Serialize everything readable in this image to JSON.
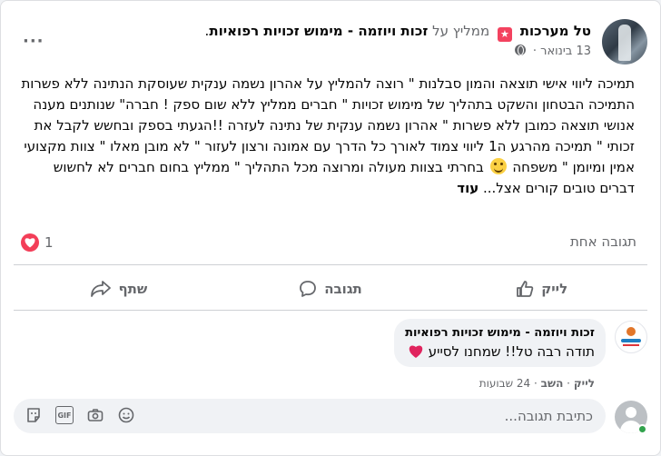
{
  "post": {
    "author_name": "טל מערכות",
    "recommends_word": "ממליץ על",
    "page_name": "זכות ויוזמה - מימוש זכויות רפואיות",
    "date": "13 בינואר",
    "more_options": "···",
    "body_lines": [
      "תמיכה ליווי אישי תוצאה והמון סבלנות \" רוצה להמליץ על אהרון נשמה ענקית שעוסקת",
      "הנתינה ללא פשרות התמיכה הבטחון והשקט בתהליך של מימוש זכויות \" חברים ממליץ",
      "ללא שום ספק ! חברה\" שנותנים מענה אנושי תוצאה כמובן ללא פשרות \" אהרון נשמה",
      "ענקית של נתינה לעזרה !!הגעתי בספק ובחשש לקבל את זכותי \" תמיכה מהרגע ה1 ליווי",
      "צמוד לאורך כל הדרך עם אמונה ורצון לעזור \" לא מובן מאלו \" צוות מקצועי אמין ומיומן \"",
      "משפחה",
      "בחרתי בצוות מעולה ומרוצה מכל התהליך \" ממליץ בחום חברים לא לחשוש",
      "דברים טובים קורים אצל...",
      "עוד"
    ]
  },
  "stats": {
    "reaction_count": "1",
    "comments_count": "תגובה אחת"
  },
  "actions": {
    "like": "לייק",
    "comment": "תגובה",
    "share": "שתף"
  },
  "comment": {
    "author": "זכות ויוזמה - מימוש זכויות רפואיות",
    "text": "תודה רבה טל!! שמחנו לסייע",
    "like": "לייק",
    "reply": "השב",
    "separator": "·",
    "time": "24 שבועות"
  },
  "composer": {
    "placeholder": "כתיבת תגובה..."
  },
  "colors": {
    "accent": "#f3425f",
    "heart": "#f33e58",
    "muted": "#65676b",
    "online": "#31a24c"
  },
  "icons": [
    "star-recommend-icon",
    "globe-icon",
    "heart-reaction-icon",
    "like-icon",
    "comment-icon",
    "share-icon",
    "sticker-icon",
    "gif-icon",
    "camera-icon",
    "emoji-icon"
  ]
}
